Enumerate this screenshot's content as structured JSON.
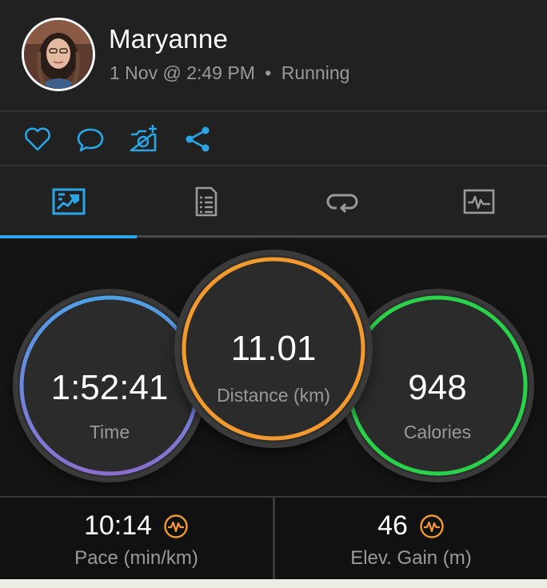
{
  "activity": {
    "user_name": "Maryanne",
    "date_time": "1 Nov @ 2:49 PM",
    "separator": "•",
    "activity_type": "Running"
  },
  "actions": {
    "icons": [
      "heart-icon",
      "comment-icon",
      "add-photo-icon",
      "share-icon"
    ],
    "accent_color": "#2aa6e6"
  },
  "tabs": {
    "items": [
      "stats-icon",
      "details-icon",
      "laps-icon",
      "charts-icon"
    ],
    "selected_index": 0
  },
  "stats": {
    "time": {
      "value": "1:52:41",
      "label": "Time"
    },
    "distance": {
      "value": "11.01",
      "label": "Distance (km)"
    },
    "calories": {
      "value": "948",
      "label": "Calories"
    }
  },
  "metrics": {
    "pace": {
      "value": "10:14",
      "label": "Pace (min/km)"
    },
    "elevation": {
      "value": "46",
      "label": "Elev. Gain (m)"
    }
  },
  "colors": {
    "time_ring": [
      "#4ea0e6",
      "#8a6fd0"
    ],
    "distance_ring": "#f29a2e",
    "calories_ring": "#2ad14a",
    "metric_icon": "#f29a2e"
  }
}
